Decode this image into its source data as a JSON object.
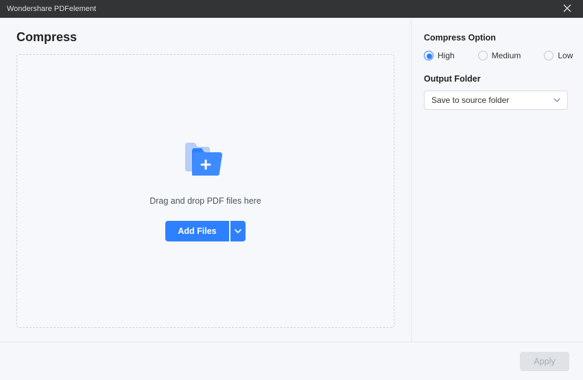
{
  "window": {
    "title": "Wondershare PDFelement"
  },
  "page": {
    "title": "Compress"
  },
  "dropzone": {
    "hint": "Drag and drop PDF files here",
    "add_label": "Add Files"
  },
  "options": {
    "compress_title": "Compress Option",
    "levels": {
      "high": "High",
      "medium": "Medium",
      "low": "Low"
    },
    "selected": "high",
    "output_title": "Output Folder",
    "output_selected": "Save to source folder"
  },
  "footer": {
    "apply_label": "Apply"
  }
}
